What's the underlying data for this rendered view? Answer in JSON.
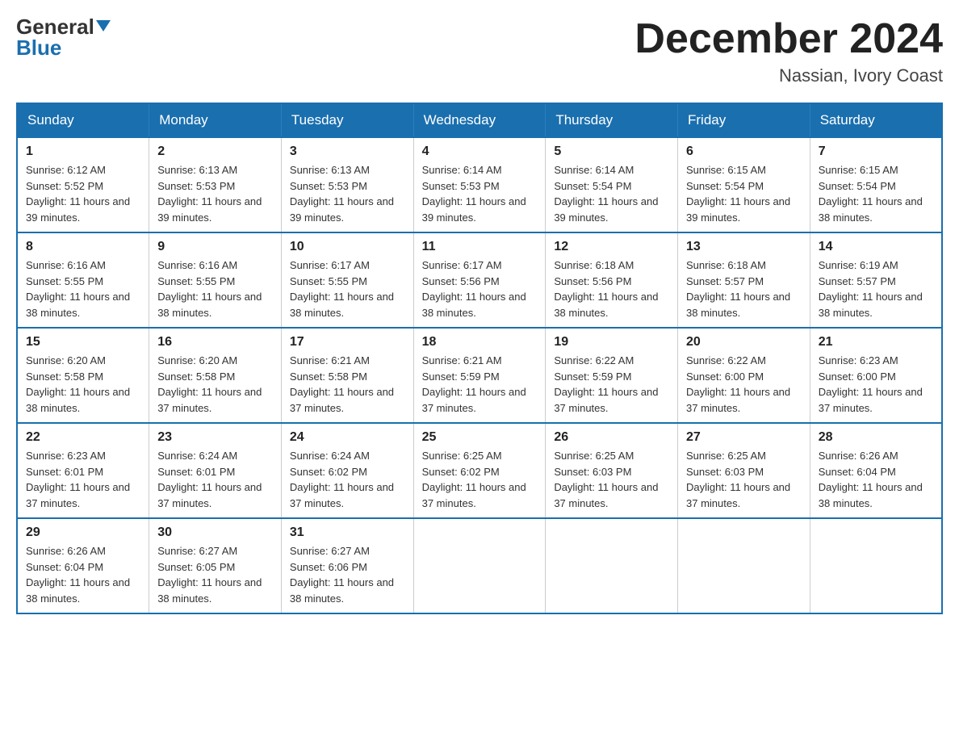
{
  "logo": {
    "general": "General",
    "blue": "Blue"
  },
  "title": {
    "month_year": "December 2024",
    "location": "Nassian, Ivory Coast"
  },
  "weekdays": [
    "Sunday",
    "Monday",
    "Tuesday",
    "Wednesday",
    "Thursday",
    "Friday",
    "Saturday"
  ],
  "weeks": [
    [
      {
        "day": "1",
        "sunrise": "6:12 AM",
        "sunset": "5:52 PM",
        "daylight": "11 hours and 39 minutes."
      },
      {
        "day": "2",
        "sunrise": "6:13 AM",
        "sunset": "5:53 PM",
        "daylight": "11 hours and 39 minutes."
      },
      {
        "day": "3",
        "sunrise": "6:13 AM",
        "sunset": "5:53 PM",
        "daylight": "11 hours and 39 minutes."
      },
      {
        "day": "4",
        "sunrise": "6:14 AM",
        "sunset": "5:53 PM",
        "daylight": "11 hours and 39 minutes."
      },
      {
        "day": "5",
        "sunrise": "6:14 AM",
        "sunset": "5:54 PM",
        "daylight": "11 hours and 39 minutes."
      },
      {
        "day": "6",
        "sunrise": "6:15 AM",
        "sunset": "5:54 PM",
        "daylight": "11 hours and 39 minutes."
      },
      {
        "day": "7",
        "sunrise": "6:15 AM",
        "sunset": "5:54 PM",
        "daylight": "11 hours and 38 minutes."
      }
    ],
    [
      {
        "day": "8",
        "sunrise": "6:16 AM",
        "sunset": "5:55 PM",
        "daylight": "11 hours and 38 minutes."
      },
      {
        "day": "9",
        "sunrise": "6:16 AM",
        "sunset": "5:55 PM",
        "daylight": "11 hours and 38 minutes."
      },
      {
        "day": "10",
        "sunrise": "6:17 AM",
        "sunset": "5:55 PM",
        "daylight": "11 hours and 38 minutes."
      },
      {
        "day": "11",
        "sunrise": "6:17 AM",
        "sunset": "5:56 PM",
        "daylight": "11 hours and 38 minutes."
      },
      {
        "day": "12",
        "sunrise": "6:18 AM",
        "sunset": "5:56 PM",
        "daylight": "11 hours and 38 minutes."
      },
      {
        "day": "13",
        "sunrise": "6:18 AM",
        "sunset": "5:57 PM",
        "daylight": "11 hours and 38 minutes."
      },
      {
        "day": "14",
        "sunrise": "6:19 AM",
        "sunset": "5:57 PM",
        "daylight": "11 hours and 38 minutes."
      }
    ],
    [
      {
        "day": "15",
        "sunrise": "6:20 AM",
        "sunset": "5:58 PM",
        "daylight": "11 hours and 38 minutes."
      },
      {
        "day": "16",
        "sunrise": "6:20 AM",
        "sunset": "5:58 PM",
        "daylight": "11 hours and 37 minutes."
      },
      {
        "day": "17",
        "sunrise": "6:21 AM",
        "sunset": "5:58 PM",
        "daylight": "11 hours and 37 minutes."
      },
      {
        "day": "18",
        "sunrise": "6:21 AM",
        "sunset": "5:59 PM",
        "daylight": "11 hours and 37 minutes."
      },
      {
        "day": "19",
        "sunrise": "6:22 AM",
        "sunset": "5:59 PM",
        "daylight": "11 hours and 37 minutes."
      },
      {
        "day": "20",
        "sunrise": "6:22 AM",
        "sunset": "6:00 PM",
        "daylight": "11 hours and 37 minutes."
      },
      {
        "day": "21",
        "sunrise": "6:23 AM",
        "sunset": "6:00 PM",
        "daylight": "11 hours and 37 minutes."
      }
    ],
    [
      {
        "day": "22",
        "sunrise": "6:23 AM",
        "sunset": "6:01 PM",
        "daylight": "11 hours and 37 minutes."
      },
      {
        "day": "23",
        "sunrise": "6:24 AM",
        "sunset": "6:01 PM",
        "daylight": "11 hours and 37 minutes."
      },
      {
        "day": "24",
        "sunrise": "6:24 AM",
        "sunset": "6:02 PM",
        "daylight": "11 hours and 37 minutes."
      },
      {
        "day": "25",
        "sunrise": "6:25 AM",
        "sunset": "6:02 PM",
        "daylight": "11 hours and 37 minutes."
      },
      {
        "day": "26",
        "sunrise": "6:25 AM",
        "sunset": "6:03 PM",
        "daylight": "11 hours and 37 minutes."
      },
      {
        "day": "27",
        "sunrise": "6:25 AM",
        "sunset": "6:03 PM",
        "daylight": "11 hours and 37 minutes."
      },
      {
        "day": "28",
        "sunrise": "6:26 AM",
        "sunset": "6:04 PM",
        "daylight": "11 hours and 38 minutes."
      }
    ],
    [
      {
        "day": "29",
        "sunrise": "6:26 AM",
        "sunset": "6:04 PM",
        "daylight": "11 hours and 38 minutes."
      },
      {
        "day": "30",
        "sunrise": "6:27 AM",
        "sunset": "6:05 PM",
        "daylight": "11 hours and 38 minutes."
      },
      {
        "day": "31",
        "sunrise": "6:27 AM",
        "sunset": "6:06 PM",
        "daylight": "11 hours and 38 minutes."
      },
      null,
      null,
      null,
      null
    ]
  ]
}
